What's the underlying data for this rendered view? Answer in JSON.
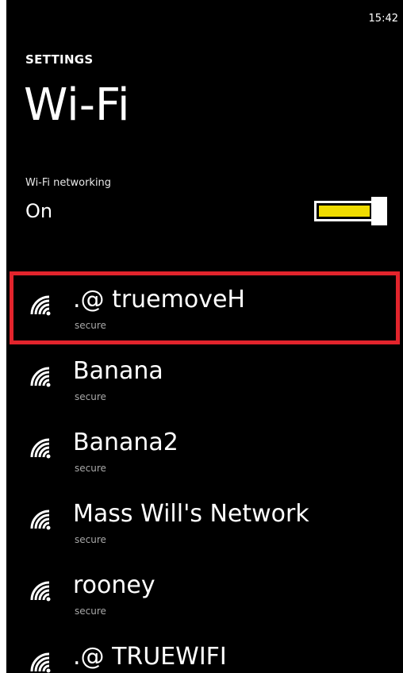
{
  "status_bar": {
    "time": "15:42"
  },
  "header": {
    "app_title": "SETTINGS",
    "page_title": "Wi-Fi"
  },
  "wifi_setting": {
    "label": "Wi-Fi networking",
    "value": "On",
    "toggle_state": "on",
    "accent_color": "#f0dc00"
  },
  "highlight_color": "#e2242c",
  "networks": [
    {
      "name": ".@  truemoveH",
      "security": "secure",
      "icon": "wifi-signal-icon",
      "highlighted": true
    },
    {
      "name": "Banana",
      "security": "secure",
      "icon": "wifi-signal-icon"
    },
    {
      "name": "Banana2",
      "security": "secure",
      "icon": "wifi-signal-icon"
    },
    {
      "name": "Mass Will's Network",
      "security": "secure",
      "icon": "wifi-signal-icon"
    },
    {
      "name": "rooney",
      "security": "secure",
      "icon": "wifi-signal-icon"
    },
    {
      "name": ".@  TRUEWIFI",
      "security": "",
      "icon": "wifi-signal-icon"
    }
  ]
}
